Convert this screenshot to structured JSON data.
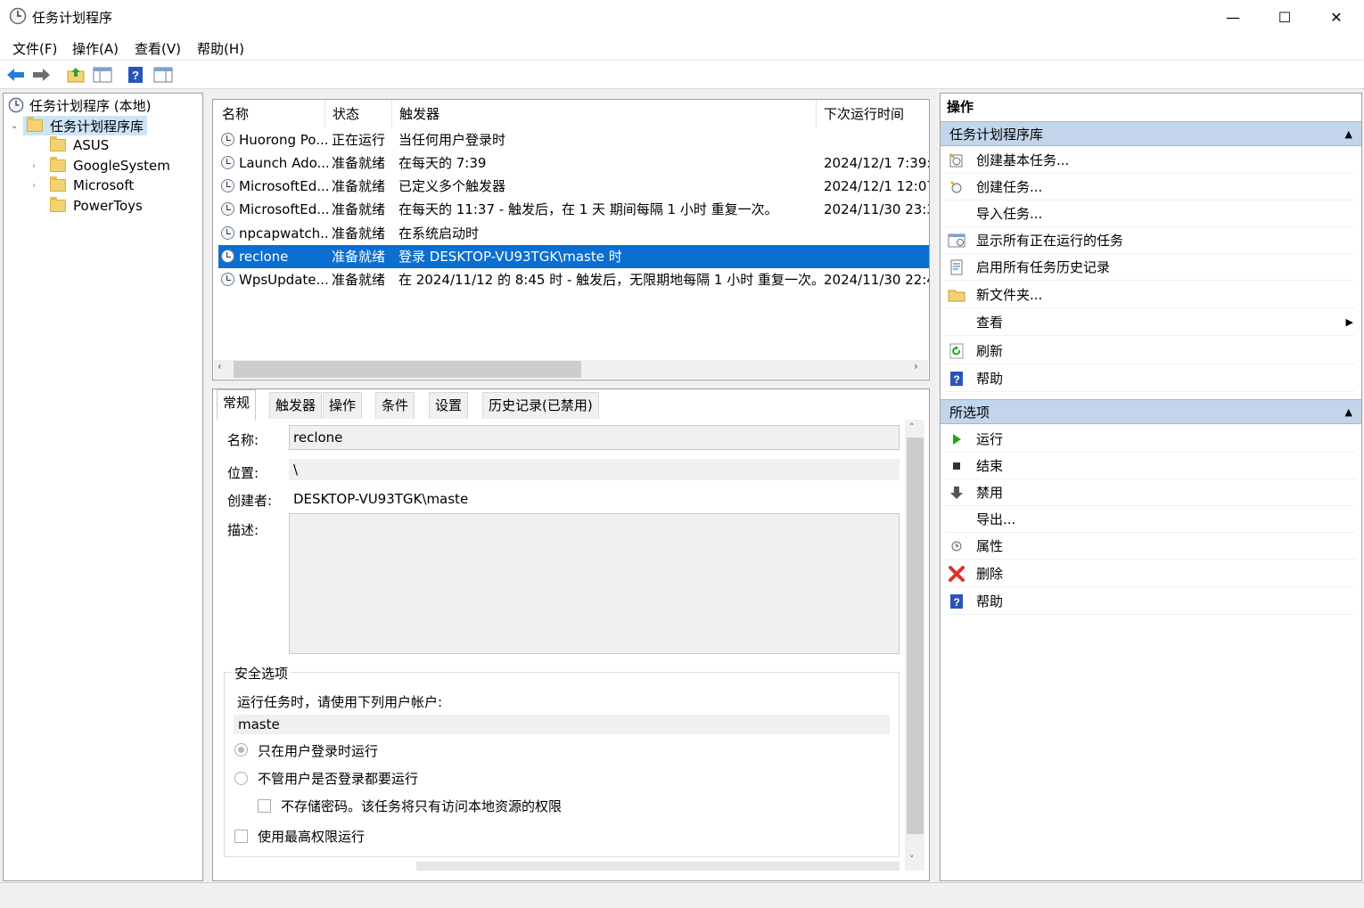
{
  "window": {
    "title": "任务计划程序",
    "minimize_glyph": "—",
    "maximize_glyph": "☐",
    "close_glyph": "✕"
  },
  "menu": [
    "文件(F)",
    "操作(A)",
    "查看(V)",
    "帮助(H)"
  ],
  "tree": {
    "root": "任务计划程序 (本地)",
    "library": "任务计划程序库",
    "folders": [
      "ASUS",
      "GoogleSystem",
      "Microsoft",
      "PowerToys"
    ]
  },
  "task_list": {
    "columns": [
      "名称",
      "状态",
      "触发器",
      "下次运行时间"
    ],
    "rows": [
      {
        "name": "Huorong Po...",
        "status": "正在运行",
        "trigger": "当任何用户登录时",
        "next": ""
      },
      {
        "name": "Launch Ado...",
        "status": "准备就绪",
        "trigger": "在每天的 7:39",
        "next": "2024/12/1 7:39:0"
      },
      {
        "name": "MicrosoftEd...",
        "status": "准备就绪",
        "trigger": "已定义多个触发器",
        "next": "2024/12/1 12:07"
      },
      {
        "name": "MicrosoftEd...",
        "status": "准备就绪",
        "trigger": "在每天的 11:37 - 触发后，在 1 天 期间每隔 1 小时 重复一次。",
        "next": "2024/11/30 23:3"
      },
      {
        "name": "npcapwatch...",
        "status": "准备就绪",
        "trigger": "在系统启动时",
        "next": ""
      },
      {
        "name": "reclone",
        "status": "准备就绪",
        "trigger": "登录 DESKTOP-VU93TGK\\maste 时",
        "next": ""
      },
      {
        "name": "WpsUpdate...",
        "status": "准备就绪",
        "trigger": "在 2024/11/12 的 8:45 时 - 触发后，无限期地每隔 1 小时 重复一次。",
        "next": "2024/11/30 22:4"
      }
    ],
    "selected_index": 5
  },
  "detail": {
    "tabs": [
      "常规",
      "触发器",
      "操作",
      "条件",
      "设置",
      "历史记录(已禁用)"
    ],
    "name_label": "名称:",
    "name_value": "reclone",
    "location_label": "位置:",
    "location_value": "\\",
    "author_label": "创建者:",
    "author_value": "DESKTOP-VU93TGK\\maste",
    "desc_label": "描述:",
    "desc_value": "",
    "security_title": "安全选项",
    "run_as_prompt": "运行任务时，请使用下列用户帐户:",
    "run_as_user": "maste",
    "opt_logged_on": "只在用户登录时运行",
    "opt_whether": "不管用户是否登录都要运行",
    "opt_no_password": "不存储密码。该任务将只有访问本地资源的权限",
    "opt_highest": "使用最高权限运行"
  },
  "actions": {
    "header": "操作",
    "section1": "任务计划程序库",
    "section1_items": [
      {
        "label": "创建基本任务...",
        "icon": "wizard-icon"
      },
      {
        "label": "创建任务...",
        "icon": "new-task-icon"
      },
      {
        "label": "导入任务...",
        "icon": ""
      },
      {
        "label": "显示所有正在运行的任务",
        "icon": "running-tasks-icon"
      },
      {
        "label": "启用所有任务历史记录",
        "icon": "history-icon"
      },
      {
        "label": "新文件夹...",
        "icon": "folder-icon"
      },
      {
        "label": "查看",
        "icon": ""
      },
      {
        "label": "刷新",
        "icon": "refresh-icon"
      },
      {
        "label": "帮助",
        "icon": "help-icon"
      }
    ],
    "section2": "所选项",
    "section2_items": [
      {
        "label": "运行",
        "icon": "run-icon"
      },
      {
        "label": "结束",
        "icon": "stop-icon"
      },
      {
        "label": "禁用",
        "icon": "disable-icon"
      },
      {
        "label": "导出...",
        "icon": ""
      },
      {
        "label": "属性",
        "icon": "properties-icon"
      },
      {
        "label": "删除",
        "icon": "delete-icon"
      },
      {
        "label": "帮助",
        "icon": "help-icon"
      }
    ]
  },
  "colors": {
    "selection": "#0a6fd1",
    "section_header": "#c3d5ea",
    "accent_blue": "#2a66c9",
    "run_green": "#1ea81e",
    "delete_red": "#e03030"
  }
}
